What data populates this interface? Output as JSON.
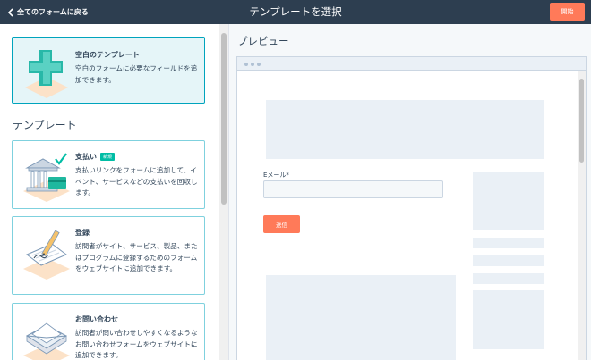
{
  "header": {
    "back_label": "全てのフォームに戻る",
    "title": "テンプレートを選択",
    "start_label": "開始"
  },
  "blank_template": {
    "title": "空白のテンプレート",
    "description": "空白のフォームに必要なフィールドを追加できます。",
    "icon": "plus-cross-icon"
  },
  "templates_section": {
    "heading": "テンプレート",
    "items": [
      {
        "title": "支払い",
        "badge": "新規",
        "description": "支払いリンクをフォームに追加して、イベント、サービスなどの支払いを回収します。",
        "icon": "bank-payment-icon"
      },
      {
        "title": "登録",
        "description": "訪問者がサイト、サービス、製品、またはプログラムに登録するためのフォームをウェブサイトに追加できます。",
        "icon": "pen-registration-icon"
      },
      {
        "title": "お問い合わせ",
        "description": "訪問者が問い合わせしやすくなるようなお問い合わせフォームをウェブサイトに追加できます。",
        "icon": "envelope-contact-icon"
      }
    ]
  },
  "preview": {
    "label": "プレビュー",
    "email_label": "Eメール*",
    "submit_label": "送信"
  },
  "colors": {
    "topbar": "#2d3e50",
    "accent": "#ff7a59",
    "teal": "#00a4bd",
    "badge": "#00bda5"
  }
}
